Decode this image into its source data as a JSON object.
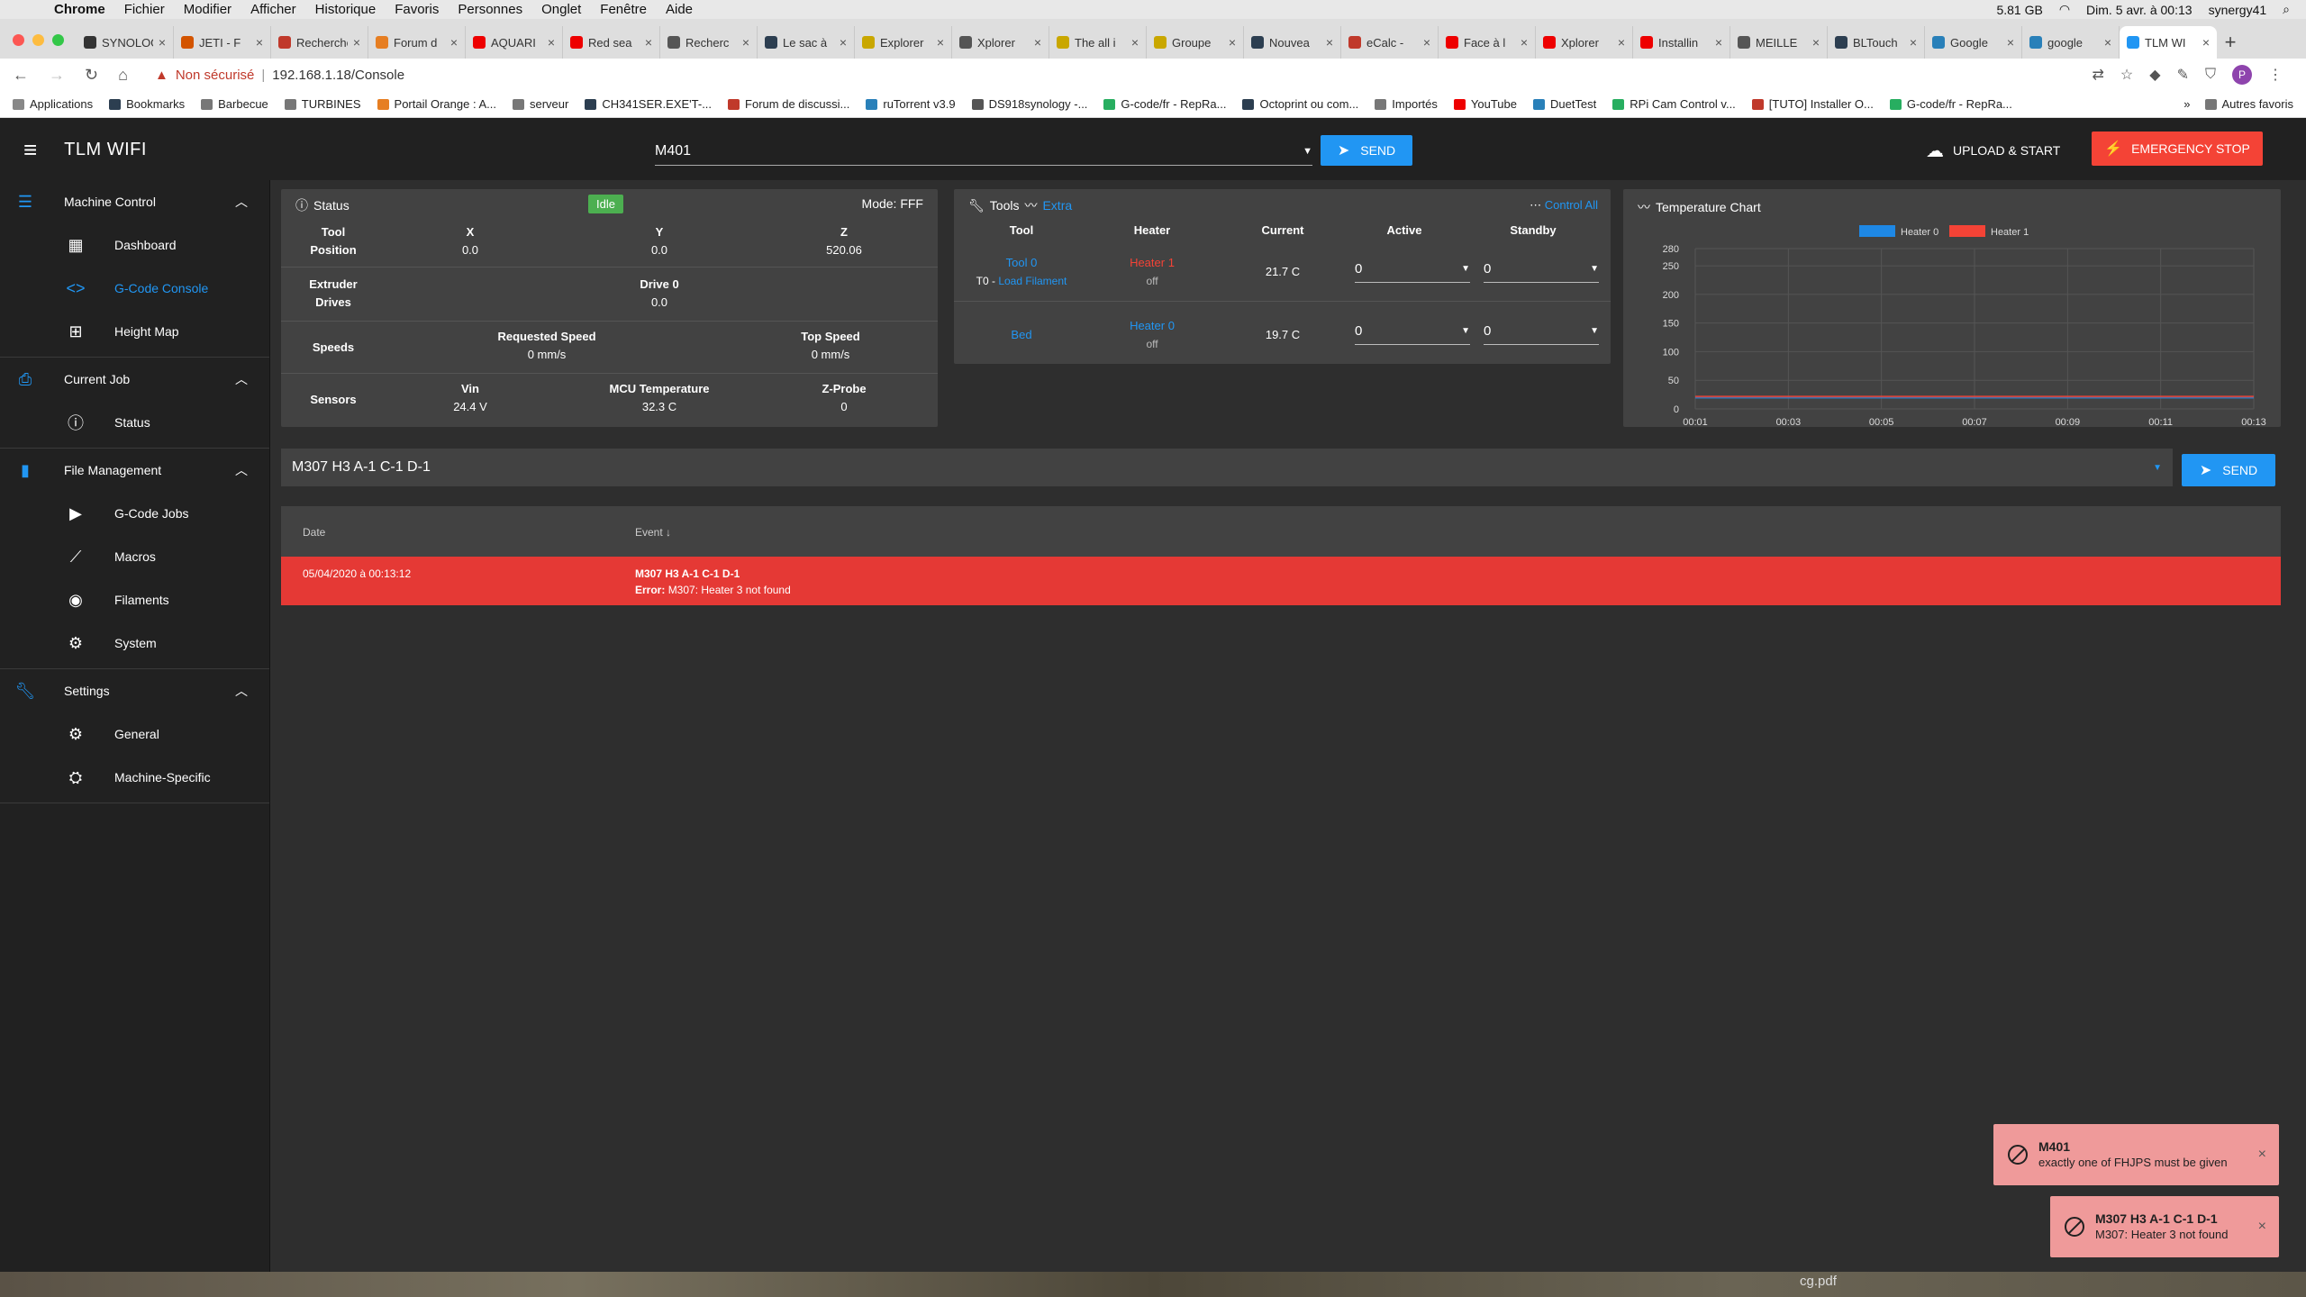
{
  "mac": {
    "apple": "",
    "menu": [
      "Chrome",
      "Fichier",
      "Modifier",
      "Afficher",
      "Historique",
      "Favoris",
      "Personnes",
      "Onglet",
      "Fenêtre",
      "Aide"
    ],
    "memory": "5.81 GB",
    "datetime": "Dim. 5 avr. à 00:13",
    "user": "synergy41"
  },
  "tabs": [
    {
      "title": "SYNOLOGY",
      "color": "#333"
    },
    {
      "title": "JETI - F",
      "color": "#d35400"
    },
    {
      "title": "Recherche",
      "color": "#c0392b"
    },
    {
      "title": "Forum d",
      "color": "#e67e22"
    },
    {
      "title": "AQUARI",
      "color": "#e00"
    },
    {
      "title": "Red sea",
      "color": "#e00"
    },
    {
      "title": "Recherc",
      "color": "#555"
    },
    {
      "title": "Le sac à",
      "color": "#2c3e50"
    },
    {
      "title": "Explorer",
      "color": "#c9a700"
    },
    {
      "title": "Xplorer",
      "color": "#555"
    },
    {
      "title": "The all i",
      "color": "#c9a700"
    },
    {
      "title": "Groupe",
      "color": "#c9a700"
    },
    {
      "title": "Nouvea",
      "color": "#2c3e50"
    },
    {
      "title": "eCalc -",
      "color": "#c0392b"
    },
    {
      "title": "Face à l",
      "color": "#e00"
    },
    {
      "title": "Xplorer",
      "color": "#e00"
    },
    {
      "title": "Installin",
      "color": "#e00"
    },
    {
      "title": "MEILLE",
      "color": "#555"
    },
    {
      "title": "BLTouch",
      "color": "#2c3e50"
    },
    {
      "title": "Google",
      "color": "#2980b9"
    },
    {
      "title": "google",
      "color": "#2980b9"
    },
    {
      "title": "TLM WI",
      "color": "#2196f3"
    }
  ],
  "omnibar": {
    "insecure": "Non sécurisé",
    "url": "192.168.1.18/Console",
    "profile": "P"
  },
  "bookmarks": [
    "Applications",
    "Bookmarks",
    "Barbecue",
    "TURBINES",
    "Portail Orange : A...",
    "serveur",
    "CH341SER.EXE'T-...",
    "Forum de discussi...",
    "ruTorrent v3.9",
    "DS918synology -...",
    "G-code/fr - RepRa...",
    "Octoprint ou com...",
    "Importés",
    "YouTube",
    "DuetTest",
    "RPi Cam Control v...",
    "[TUTO] Installer O...",
    "G-code/fr - RepRa..."
  ],
  "bookmarks_more": "»",
  "bookmarks_other": "Autres favoris",
  "app": {
    "title": "TLM WIFI",
    "command": "M401",
    "send": "SEND",
    "upload": "UPLOAD & START",
    "estop": "EMERGENCY STOP"
  },
  "sidebar": {
    "groups": [
      {
        "title": "Machine Control",
        "items": [
          "Dashboard",
          "G-Code Console",
          "Height Map"
        ]
      },
      {
        "title": "Current Job",
        "items": [
          "Status"
        ]
      },
      {
        "title": "File Management",
        "items": [
          "G-Code Jobs",
          "Macros",
          "Filaments",
          "System"
        ]
      },
      {
        "title": "Settings",
        "items": [
          "General",
          "Machine-Specific"
        ]
      }
    ]
  },
  "status": {
    "title": "Status",
    "state": "Idle",
    "mode": "Mode: FFF",
    "tool_position_label1": "Tool",
    "tool_position_label2": "Position",
    "axes": [
      {
        "name": "X",
        "value": "0.0"
      },
      {
        "name": "Y",
        "value": "0.0"
      },
      {
        "name": "Z",
        "value": "520.06"
      }
    ],
    "extruder_label1": "Extruder",
    "extruder_label2": "Drives",
    "drive_name": "Drive 0",
    "drive_value": "0.0",
    "speeds_label": "Speeds",
    "req_speed_label": "Requested Speed",
    "req_speed": "0 mm/s",
    "top_speed_label": "Top Speed",
    "top_speed": "0 mm/s",
    "sensors_label": "Sensors",
    "vin_label": "Vin",
    "vin": "24.4 V",
    "mcu_label": "MCU Temperature",
    "mcu": "32.3 C",
    "zprobe_label": "Z-Probe",
    "zprobe": "0"
  },
  "tools": {
    "title": "Tools",
    "extra": "Extra",
    "control_all": "Control All",
    "headers": [
      "Tool",
      "Heater",
      "Current",
      "Active",
      "Standby"
    ],
    "rows": [
      {
        "tool": "Tool 0",
        "sub_prefix": "T0 -",
        "sub_link": "Load Filament",
        "heater": "Heater 1",
        "heater_state": "off",
        "current": "21.7 C",
        "active": "0",
        "standby": "0"
      },
      {
        "tool": "Bed",
        "heater": "Heater 0",
        "heater_state": "off",
        "current": "19.7 C",
        "active": "0",
        "standby": "0"
      }
    ]
  },
  "temp_chart": {
    "title": "Temperature Chart"
  },
  "chart_data": {
    "type": "line",
    "title": "Temperature Chart",
    "x": [
      "00:01",
      "00:03",
      "00:05",
      "00:07",
      "00:09",
      "00:11",
      "00:13"
    ],
    "yticks": [
      0,
      50,
      100,
      150,
      200,
      250,
      280
    ],
    "ylim": [
      0,
      280
    ],
    "series": [
      {
        "name": "Heater 0",
        "color": "#1e88e5",
        "values": [
          19.7,
          19.7,
          19.7,
          19.7,
          19.7,
          19.7,
          19.7
        ]
      },
      {
        "name": "Heater 1",
        "color": "#f44336",
        "values": [
          21.7,
          21.7,
          21.7,
          21.7,
          21.7,
          21.7,
          21.7
        ]
      }
    ],
    "grid": true,
    "legend": "top"
  },
  "console": {
    "input": "M307 H3 A-1 C-1 D-1",
    "send": "SEND"
  },
  "log": {
    "col_date": "Date",
    "col_event": "Event",
    "sort": "↓",
    "rows": [
      {
        "date": "05/04/2020 à 00:13:12",
        "command": "M307 H3 A-1 C-1 D-1",
        "error_label": "Error:",
        "message": "M307: Heater 3 not found"
      }
    ]
  },
  "toasts": [
    {
      "title": "M401",
      "message": "exactly one of FHJPS must be given"
    },
    {
      "title": "M307 H3 A-1 C-1 D-1",
      "message": "M307: Heater 3 not found"
    }
  ],
  "desktop": {
    "file": "cg.pdf"
  }
}
